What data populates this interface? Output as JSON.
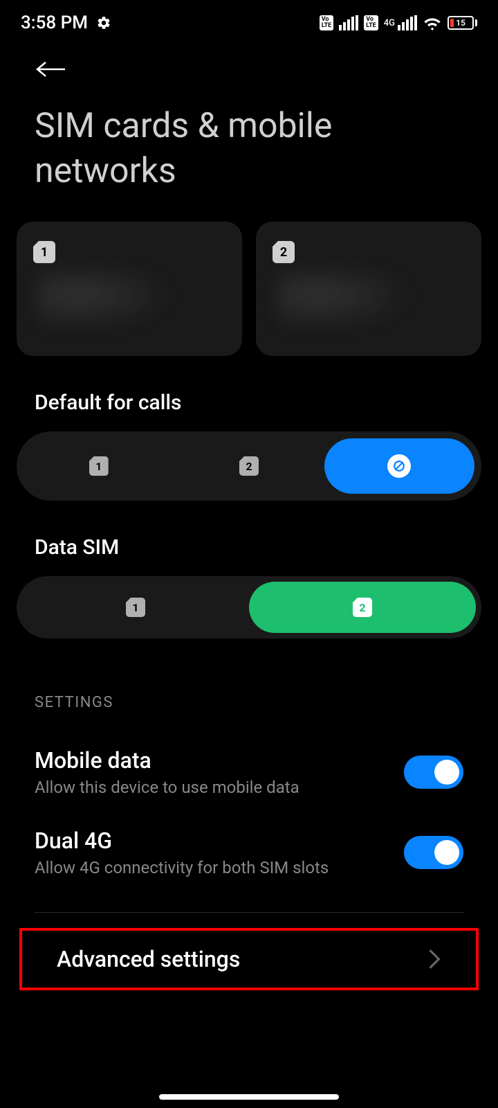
{
  "status_bar": {
    "time": "3:58 PM",
    "network_label": "4G",
    "battery_level": "15"
  },
  "page": {
    "title": "SIM cards & mobile networks"
  },
  "sim_cards": {
    "card1_label": "1",
    "card2_label": "2"
  },
  "default_calls": {
    "label": "Default for calls",
    "sim1": "1",
    "sim2": "2",
    "selected_index": 2
  },
  "data_sim": {
    "label": "Data SIM",
    "sim1": "1",
    "sim2": "2",
    "selected_index": 1
  },
  "settings": {
    "header": "SETTINGS",
    "mobile_data": {
      "title": "Mobile data",
      "subtitle": "Allow this device to use mobile data",
      "enabled": true
    },
    "dual_4g": {
      "title": "Dual 4G",
      "subtitle": "Allow 4G connectivity for both SIM slots",
      "enabled": true
    },
    "advanced": {
      "title": "Advanced settings"
    }
  }
}
